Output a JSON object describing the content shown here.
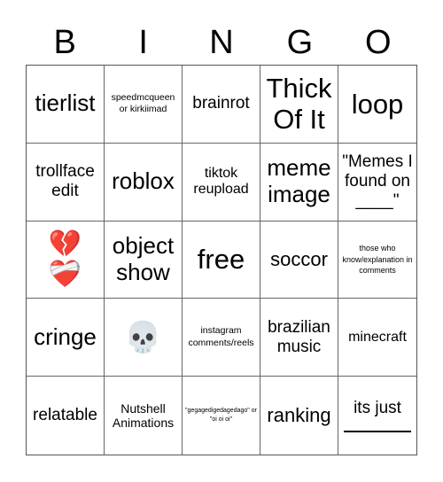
{
  "header": {
    "letters": [
      "B",
      "I",
      "N",
      "G",
      "O"
    ]
  },
  "cells": [
    {
      "text": "tierlist"
    },
    {
      "text": "speedmcqueen or kirkiimad"
    },
    {
      "text": "brainrot"
    },
    {
      "text": "Thick Of It"
    },
    {
      "text": "loop"
    },
    {
      "text": "trollface edit"
    },
    {
      "text": "roblox"
    },
    {
      "text": "tiktok reupload"
    },
    {
      "text": "meme image"
    },
    {
      "text": "\"Memes I found on ____\""
    },
    {
      "emoji": [
        "💔",
        "❤️‍🩹"
      ],
      "icon": "broken-heart-and-mending-heart"
    },
    {
      "text": "object show"
    },
    {
      "text": "free"
    },
    {
      "text": "soccor"
    },
    {
      "text": "those who know/explanation in comments"
    },
    {
      "text": "cringe"
    },
    {
      "emoji": [
        "💀"
      ],
      "icon": "skull"
    },
    {
      "text": "instagram comments/reels"
    },
    {
      "text": "brazilian music"
    },
    {
      "text": "minecraft"
    },
    {
      "text": "relatable"
    },
    {
      "text": "Nutshell Animations"
    },
    {
      "text": "\"gegagedigedagedago\" or \"oi oi oi\""
    },
    {
      "text": "ranking"
    },
    {
      "text": "its just",
      "blank": "________"
    }
  ]
}
